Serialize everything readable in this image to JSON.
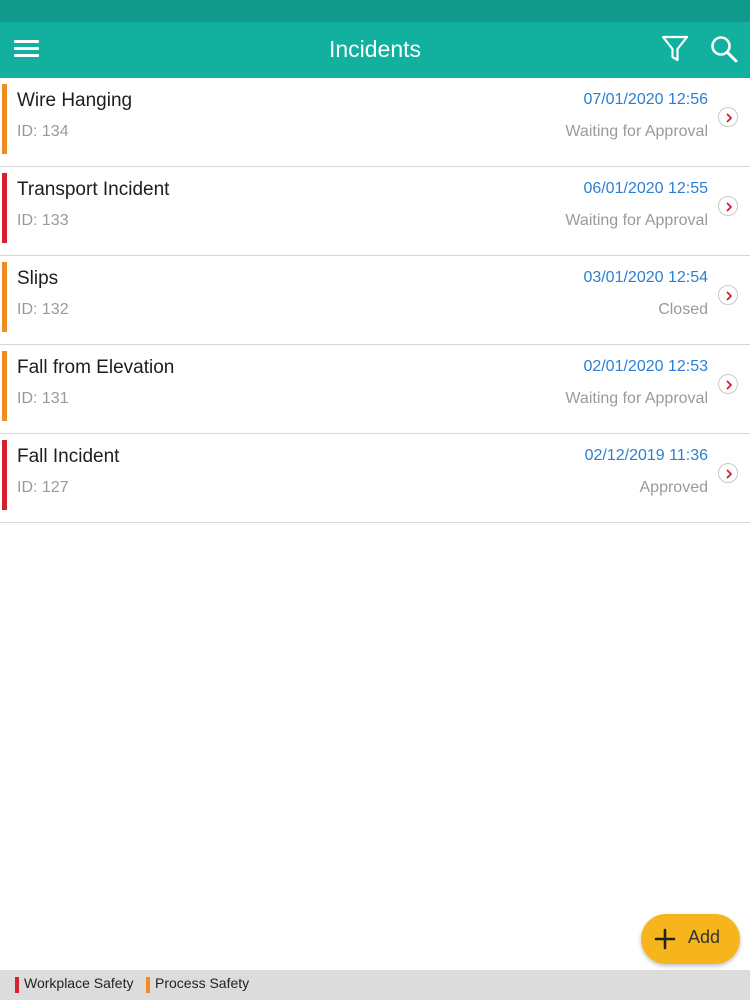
{
  "header": {
    "title": "Incidents",
    "menu_icon": "hamburger-menu-icon",
    "filter_icon": "filter-icon",
    "search_icon": "search-icon",
    "color": "#12b09f"
  },
  "categories": {
    "workplace": {
      "label": "Workplace Safety",
      "color": "#d5202e"
    },
    "process": {
      "label": "Process Safety",
      "color": "#f28c20"
    }
  },
  "incidents": [
    {
      "name": "Wire Hanging",
      "id": "ID: 134",
      "date": "07/01/2020 12:56",
      "status": "Waiting for Approval",
      "category": "process"
    },
    {
      "name": "Transport Incident",
      "id": "ID: 133",
      "date": "06/01/2020 12:55",
      "status": "Waiting for Approval",
      "category": "workplace"
    },
    {
      "name": "Slips",
      "id": "ID: 132",
      "date": "03/01/2020 12:54",
      "status": "Closed",
      "category": "process"
    },
    {
      "name": "Fall from Elevation",
      "id": "ID: 131",
      "date": "02/01/2020 12:53",
      "status": "Waiting for Approval",
      "category": "process"
    },
    {
      "name": "Fall Incident",
      "id": "ID: 127",
      "date": "02/12/2019 11:36",
      "status": "Approved",
      "category": "workplace"
    }
  ],
  "add_button": {
    "label": "Add",
    "icon": "plus-icon",
    "color": "#f7b51d"
  },
  "legend": {
    "workplace_label": "Workplace Safety",
    "process_label": "Process Safety"
  }
}
